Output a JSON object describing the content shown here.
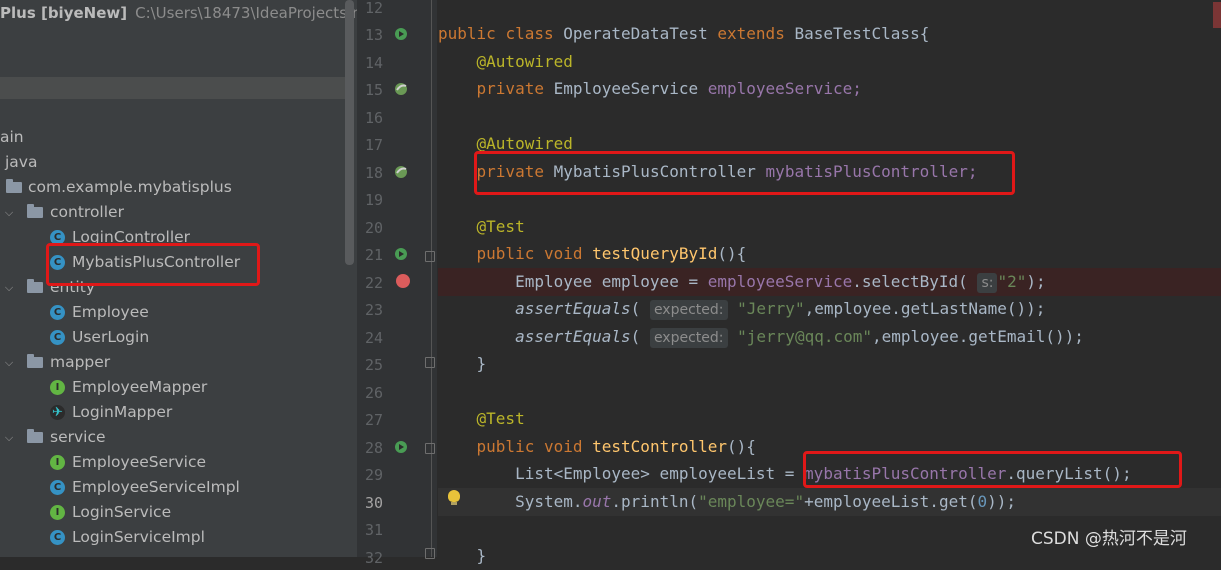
{
  "project": {
    "name": "Plus [biyeNew]",
    "path": "C:\\Users\\18473\\IdeaProjects\\myb",
    "tree": [
      {
        "label": "ain",
        "kind": "text"
      },
      {
        "label": "java",
        "kind": "text"
      },
      {
        "label": "com.example.mybatisplus",
        "kind": "package"
      },
      {
        "label": "controller",
        "kind": "folder"
      },
      {
        "label": "LoginController",
        "kind": "class"
      },
      {
        "label": "MybatisPlusController",
        "kind": "class"
      },
      {
        "label": "entity",
        "kind": "folder"
      },
      {
        "label": "Employee",
        "kind": "class"
      },
      {
        "label": "UserLogin",
        "kind": "class"
      },
      {
        "label": "mapper",
        "kind": "folder"
      },
      {
        "label": "EmployeeMapper",
        "kind": "interface"
      },
      {
        "label": "LoginMapper",
        "kind": "mapper"
      },
      {
        "label": "service",
        "kind": "folder"
      },
      {
        "label": "EmployeeService",
        "kind": "interface"
      },
      {
        "label": "EmployeeServiceImpl",
        "kind": "class"
      },
      {
        "label": "LoginService",
        "kind": "interface"
      },
      {
        "label": "LoginServiceImpl",
        "kind": "class"
      }
    ]
  },
  "editor": {
    "line_numbers": [
      "12",
      "13",
      "14",
      "15",
      "16",
      "17",
      "18",
      "19",
      "20",
      "21",
      "22",
      "23",
      "24",
      "25",
      "26",
      "27",
      "28",
      "29",
      "30",
      "31",
      "32"
    ],
    "current_line": "30",
    "code": {
      "l13": {
        "kw1": "public",
        "kw2": "class",
        "name": "OperateDataTest",
        "kw3": "extends",
        "base": "BaseTestClass{"
      },
      "l14": {
        "ann": "@Autowired"
      },
      "l15": {
        "kw": "private",
        "type": "EmployeeService",
        "field": "employeeService;"
      },
      "l17": {
        "ann": "@Autowired"
      },
      "l18": {
        "kw": "private",
        "type": "MybatisPlusController",
        "field": "mybatisPlusController;"
      },
      "l20": {
        "ann": "@Test"
      },
      "l21": {
        "kw1": "public",
        "kw2": "void",
        "fn": "testQueryById",
        "rest": "(){"
      },
      "l22": {
        "a": "Employee employee = ",
        "field": "employeeService",
        "b": ".selectById(",
        "hint": "s:",
        "str": "\"2\"",
        "c": ");"
      },
      "l23": {
        "fn": "assertEquals",
        "a": "(",
        "hint": "expected:",
        "str": "\"Jerry\"",
        "b": ",employee.getLastName());"
      },
      "l24": {
        "fn": "assertEquals",
        "a": "(",
        "hint": "expected:",
        "str": "\"jerry@qq.com\"",
        "b": ",employee.getEmail());"
      },
      "l25": {
        "a": "}"
      },
      "l27": {
        "ann": "@Test"
      },
      "l28": {
        "kw1": "public",
        "kw2": "void",
        "fn": "testController",
        "rest": "(){"
      },
      "l29": {
        "a": "List<Employee> employeeList = ",
        "field": "mybatisPlusController",
        "b": ".queryList();"
      },
      "l30": {
        "a": "System.",
        "field": "out",
        "b": ".println(",
        "str": "\"employee=\"",
        "c": "+employeeList.get(",
        "num": "0",
        "d": "));"
      },
      "l32": {
        "a": "}"
      }
    }
  },
  "watermark": "CSDN @热河不是河",
  "colors": {
    "highlight_box": "#e01818",
    "keyword": "#cc7832",
    "annotation": "#bbb529",
    "field": "#9876aa",
    "method": "#ffc66d",
    "string": "#6a8759"
  }
}
